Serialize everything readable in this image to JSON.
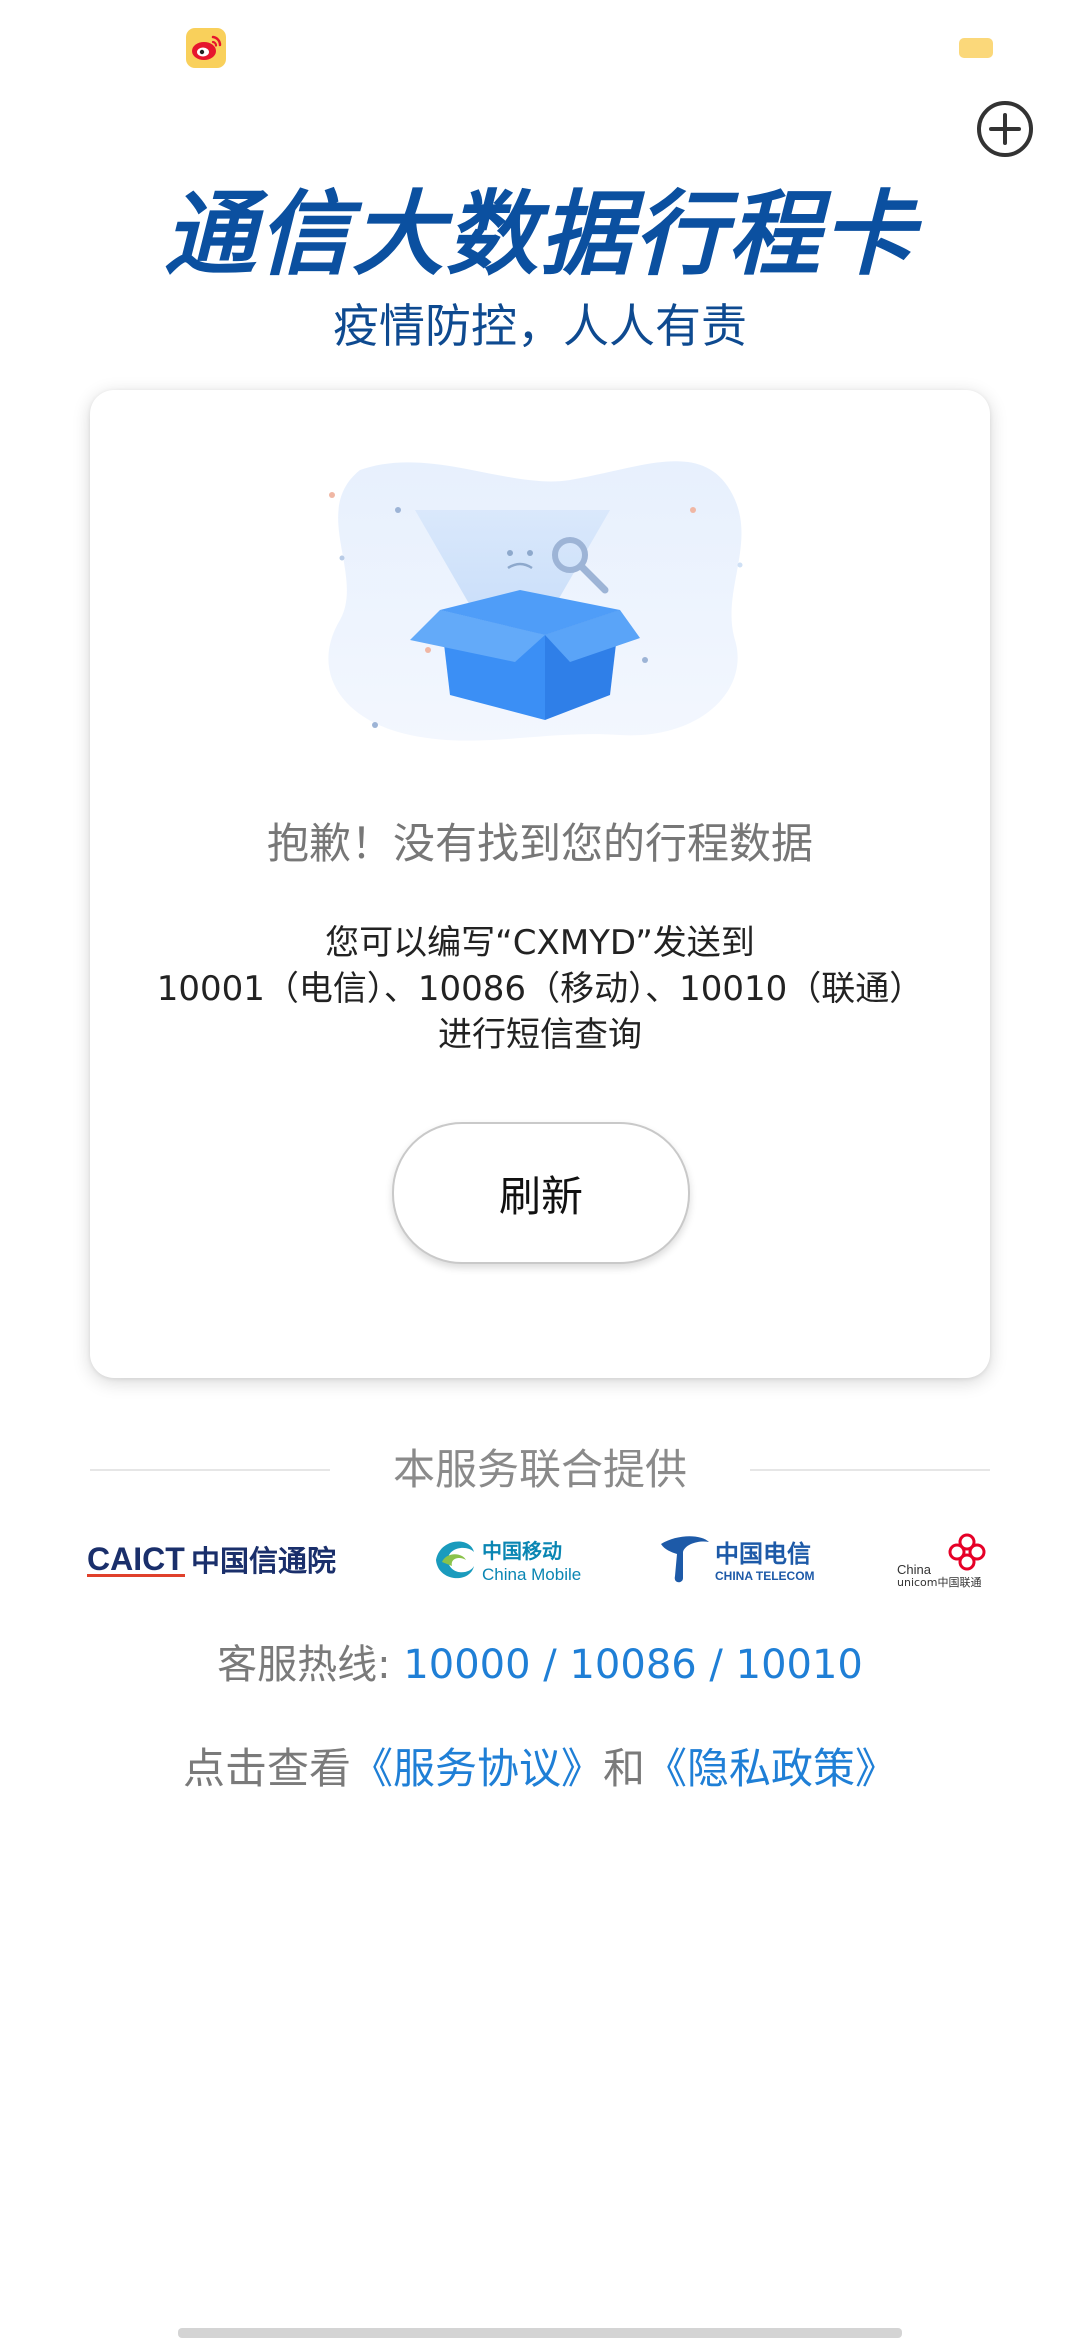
{
  "status_bar": {
    "app_icon": "weibo-icon",
    "battery_icon": "battery-icon",
    "battery_color": "#fbd87a"
  },
  "header": {
    "add_icon": "plus-circle-icon",
    "title": "通信大数据行程卡",
    "subtitle": "疫情防控，人人有责"
  },
  "card": {
    "illustration": "empty-box-illustration",
    "sorry_text": "抱歉！没有找到您的行程数据",
    "hint_line1": "您可以编写“CXMYD”发送到",
    "hint_line2": "10001（电信）、10086（移动）、10010（联通）",
    "hint_line3": "进行短信查询",
    "refresh_label": "刷新"
  },
  "providers": {
    "title": "本服务联合提供",
    "logos": [
      {
        "name": "caict-logo",
        "text_a": "CAICT",
        "text_b": "中国信通院"
      },
      {
        "name": "china-mobile-logo",
        "text_a": "中国移动",
        "text_b": "China Mobile"
      },
      {
        "name": "china-telecom-logo",
        "text_a": "中国电信",
        "text_b": "CHINA TELECOM"
      },
      {
        "name": "china-unicom-logo",
        "text_a": "China",
        "text_b": "unicom中国联通"
      }
    ]
  },
  "hotline": {
    "label": "客服热线: ",
    "numbers": "10000 / 10086 / 10010"
  },
  "agreements": {
    "prefix": "点击查看",
    "service_link": "《服务协议》",
    "conjunction": "和",
    "privacy_link": "《隐私政策》"
  },
  "colors": {
    "brand_blue": "#0b50a0",
    "link_blue": "#1f7fd6",
    "button_border": "#c9c9c9"
  }
}
